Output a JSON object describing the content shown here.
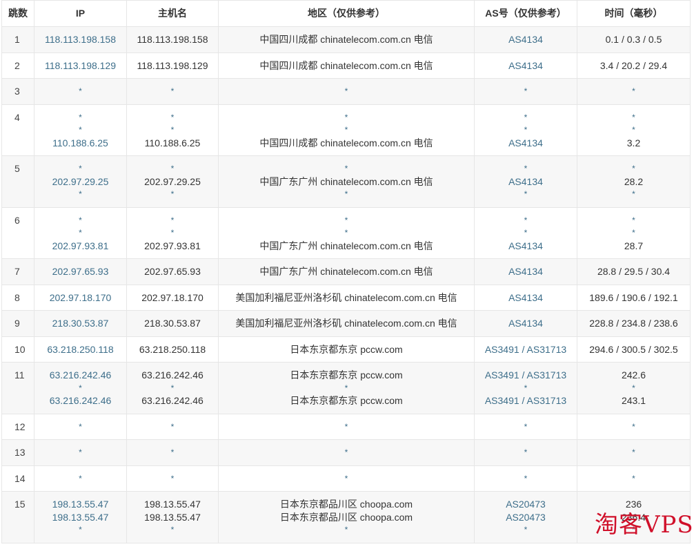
{
  "headers": {
    "hop": "跳数",
    "ip": "IP",
    "host": "主机名",
    "geo": "地区（仅供参考）",
    "as": "AS号（仅供参考）",
    "time": "时间（毫秒）"
  },
  "rows": [
    {
      "hop": "1",
      "ip": [
        "118.113.198.158"
      ],
      "host": [
        "118.113.198.158"
      ],
      "geo": [
        "中国四川成都 chinatelecom.com.cn 电信"
      ],
      "as": [
        "AS4134"
      ],
      "time": [
        "0.1 / 0.3 / 0.5"
      ]
    },
    {
      "hop": "2",
      "ip": [
        "118.113.198.129"
      ],
      "host": [
        "118.113.198.129"
      ],
      "geo": [
        "中国四川成都 chinatelecom.com.cn 电信"
      ],
      "as": [
        "AS4134"
      ],
      "time": [
        "3.4 / 20.2 / 29.4"
      ]
    },
    {
      "hop": "3",
      "ip": [
        "*"
      ],
      "host": [
        "*"
      ],
      "geo": [
        "*"
      ],
      "as": [
        "*"
      ],
      "time": [
        "*"
      ]
    },
    {
      "hop": "4",
      "ip": [
        "*",
        "*",
        "110.188.6.25"
      ],
      "host": [
        "*",
        "*",
        "110.188.6.25"
      ],
      "geo": [
        "*",
        "*",
        "中国四川成都 chinatelecom.com.cn 电信"
      ],
      "as": [
        "*",
        "*",
        "AS4134"
      ],
      "time": [
        "*",
        "*",
        "3.2"
      ]
    },
    {
      "hop": "5",
      "ip": [
        "*",
        "202.97.29.25",
        "*"
      ],
      "host": [
        "*",
        "202.97.29.25",
        "*"
      ],
      "geo": [
        "*",
        "中国广东广州 chinatelecom.com.cn 电信",
        "*"
      ],
      "as": [
        "*",
        "AS4134",
        "*"
      ],
      "time": [
        "*",
        "28.2",
        "*"
      ]
    },
    {
      "hop": "6",
      "ip": [
        "*",
        "*",
        "202.97.93.81"
      ],
      "host": [
        "*",
        "*",
        "202.97.93.81"
      ],
      "geo": [
        "*",
        "*",
        "中国广东广州 chinatelecom.com.cn 电信"
      ],
      "as": [
        "*",
        "*",
        "AS4134"
      ],
      "time": [
        "*",
        "*",
        "28.7"
      ]
    },
    {
      "hop": "7",
      "ip": [
        "202.97.65.93"
      ],
      "host": [
        "202.97.65.93"
      ],
      "geo": [
        "中国广东广州 chinatelecom.com.cn 电信"
      ],
      "as": [
        "AS4134"
      ],
      "time": [
        "28.8 / 29.5 / 30.4"
      ]
    },
    {
      "hop": "8",
      "ip": [
        "202.97.18.170"
      ],
      "host": [
        "202.97.18.170"
      ],
      "geo": [
        "美国加利福尼亚州洛杉矶 chinatelecom.com.cn 电信"
      ],
      "as": [
        "AS4134"
      ],
      "time": [
        "189.6 / 190.6 / 192.1"
      ]
    },
    {
      "hop": "9",
      "ip": [
        "218.30.53.87"
      ],
      "host": [
        "218.30.53.87"
      ],
      "geo": [
        "美国加利福尼亚州洛杉矶 chinatelecom.com.cn 电信"
      ],
      "as": [
        "AS4134"
      ],
      "time": [
        "228.8 / 234.8 / 238.6"
      ]
    },
    {
      "hop": "10",
      "ip": [
        "63.218.250.118"
      ],
      "host": [
        "63.218.250.118"
      ],
      "geo": [
        "日本东京都东京 pccw.com"
      ],
      "as": [
        "AS3491 / AS31713"
      ],
      "time": [
        "294.6 / 300.5 / 302.5"
      ]
    },
    {
      "hop": "11",
      "ip": [
        "63.216.242.46",
        "*",
        "63.216.242.46"
      ],
      "host": [
        "63.216.242.46",
        "*",
        "63.216.242.46"
      ],
      "geo": [
        "日本东京都东京 pccw.com",
        "*",
        "日本东京都东京 pccw.com"
      ],
      "as": [
        "AS3491 / AS31713",
        "*",
        "AS3491 / AS31713"
      ],
      "time": [
        "242.6",
        "*",
        "243.1"
      ]
    },
    {
      "hop": "12",
      "ip": [
        "*"
      ],
      "host": [
        "*"
      ],
      "geo": [
        "*"
      ],
      "as": [
        "*"
      ],
      "time": [
        "*"
      ]
    },
    {
      "hop": "13",
      "ip": [
        "*"
      ],
      "host": [
        "*"
      ],
      "geo": [
        "*"
      ],
      "as": [
        "*"
      ],
      "time": [
        "*"
      ]
    },
    {
      "hop": "14",
      "ip": [
        "*"
      ],
      "host": [
        "*"
      ],
      "geo": [
        "*"
      ],
      "as": [
        "*"
      ],
      "time": [
        "*"
      ]
    },
    {
      "hop": "15",
      "ip": [
        "198.13.55.47",
        "198.13.55.47",
        "*"
      ],
      "host": [
        "198.13.55.47",
        "198.13.55.47",
        "*"
      ],
      "geo": [
        "日本东京都品川区 choopa.com",
        "日本东京都品川区 choopa.com",
        "*"
      ],
      "as": [
        "AS20473",
        "AS20473",
        "*"
      ],
      "time": [
        "236",
        "236.4",
        "*"
      ]
    }
  ],
  "watermark": "淘客VPS"
}
